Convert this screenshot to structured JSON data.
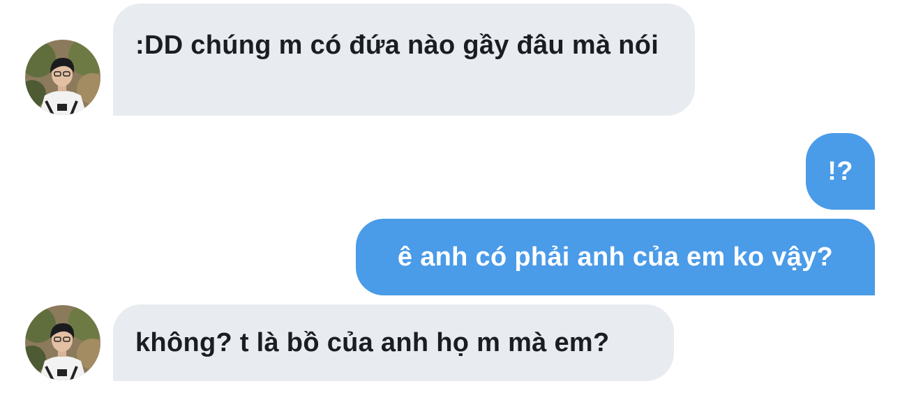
{
  "conversation": {
    "messages": [
      {
        "direction": "incoming",
        "text": ":DD chúng m có đứa nào gầy đâu mà nói",
        "avatar": "contact-avatar"
      },
      {
        "direction": "outgoing",
        "text": "!?"
      },
      {
        "direction": "outgoing",
        "text": "ê anh có phải anh của em ko vậy?"
      },
      {
        "direction": "incoming",
        "text": "không? t là bồ của anh họ m mà em?",
        "avatar": "contact-avatar"
      }
    ]
  },
  "colors": {
    "incoming_bubble": "#e8ebef",
    "incoming_text": "#1a1d21",
    "outgoing_bubble": "#4a9be8",
    "outgoing_text": "#ffffff",
    "background": "#ffffff"
  }
}
